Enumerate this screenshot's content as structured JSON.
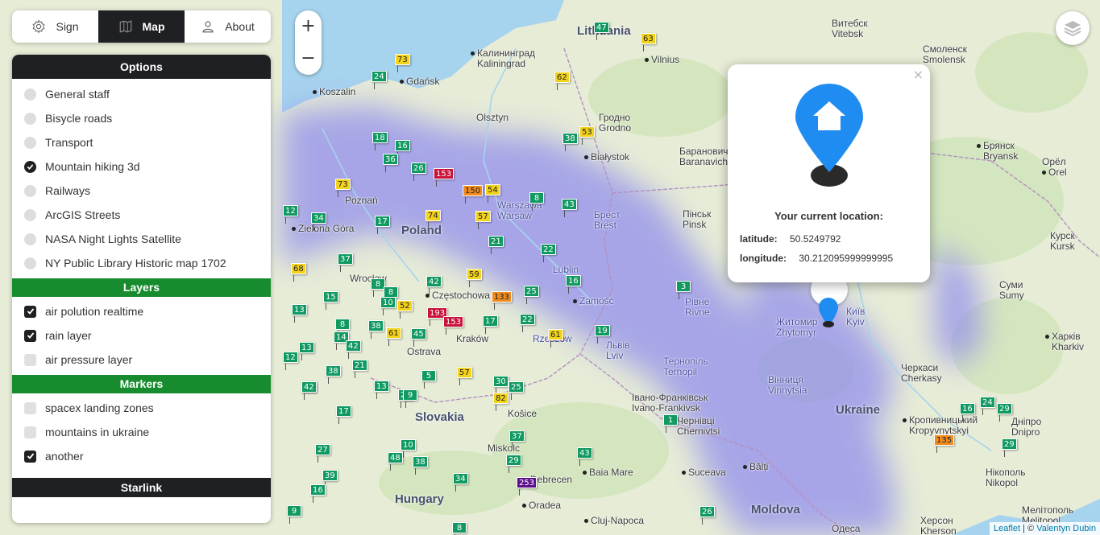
{
  "nav": {
    "tabs": [
      {
        "label": "Sign",
        "icon": "gear-icon"
      },
      {
        "label": "Map",
        "icon": "map-icon",
        "active": true
      },
      {
        "label": "About",
        "icon": "user-icon"
      }
    ]
  },
  "sidebar": {
    "options_title": "Options",
    "options": [
      {
        "label": "General staff",
        "selected": false
      },
      {
        "label": "Bisycle roads",
        "selected": false
      },
      {
        "label": "Transport",
        "selected": false
      },
      {
        "label": "Mountain hiking 3d",
        "selected": true
      },
      {
        "label": "Railways",
        "selected": false
      },
      {
        "label": "ArcGIS Streets",
        "selected": false
      },
      {
        "label": "NASA Night Lights Satellite",
        "selected": false
      },
      {
        "label": "NY Public Library Historic map 1702",
        "selected": false
      }
    ],
    "layers_title": "Layers",
    "layers": [
      {
        "label": "air polution realtime",
        "checked": true
      },
      {
        "label": "rain layer",
        "checked": true
      },
      {
        "label": "air pressure layer",
        "checked": false
      }
    ],
    "markers_title": "Markers",
    "markers": [
      {
        "label": "spacex landing zones",
        "checked": false
      },
      {
        "label": "mountains in ukraine",
        "checked": false
      },
      {
        "label": "another",
        "checked": true
      }
    ],
    "starlink_title": "Starlink"
  },
  "map": {
    "zoom_in": "+",
    "zoom_out": "−",
    "countries": [
      "Poland",
      "Slovakia",
      "Hungary",
      "Ukraine",
      "Moldova",
      "Lithuania"
    ],
    "cities": [
      "Koszalin",
      "Gdańsk",
      "Калининград",
      "Kaliningrad",
      "Olsztyn",
      "Vilnius",
      "Гродно",
      "Grodno",
      "Białystok",
      "Poznań",
      "Zielona Góra",
      "Warszawa",
      "Warsaw",
      "Брест",
      "Brest",
      "Lublin",
      "Zamość",
      "Częstochowa",
      "Kraków",
      "Rzeszów",
      "Wrocław",
      "Ostrava",
      "Košice",
      "Miskolc",
      "Debrecen",
      "Oradea",
      "Львів",
      "Lviv",
      "Тернопіль",
      "Ternopil",
      "Івано-Франківськ",
      "Ivano-Frankivsk",
      "Чернівці",
      "Chernivtsi",
      "Suceava",
      "Bălți",
      "Baia Mare",
      "Cluj-Napoca",
      "Пінськ",
      "Pinsk",
      "Рівне",
      "Rivne",
      "Житомир",
      "Zhytomyr",
      "Київ",
      "Kyiv",
      "Вінниця",
      "Vinnytsia",
      "Черкаси",
      "Cherkasy",
      "Кропивницький",
      "Kropyvnytskyi",
      "Дніпро",
      "Dnipro",
      "Нікополь",
      "Nikopol",
      "Мелітополь",
      "Melitopol",
      "Херсон",
      "Kherson",
      "Одеса",
      "Барановичи",
      "Baranavichy",
      "Витебск",
      "Vitebsk",
      "Смоленск",
      "Smolensk",
      "Брянск",
      "Bryansk",
      "Орёл",
      "Orel",
      "Курск",
      "Kursk",
      "Суми",
      "Sumy",
      "Харків",
      "Kharkiv"
    ],
    "aqi_markers": [
      {
        "v": "47",
        "c": "g"
      },
      {
        "v": "63",
        "c": "y"
      },
      {
        "v": "73",
        "c": "y"
      },
      {
        "v": "24",
        "c": "g"
      },
      {
        "v": "62",
        "c": "y"
      },
      {
        "v": "53",
        "c": "y"
      },
      {
        "v": "38",
        "c": "g"
      },
      {
        "v": "18",
        "c": "g"
      },
      {
        "v": "16",
        "c": "g"
      },
      {
        "v": "36",
        "c": "g"
      },
      {
        "v": "26",
        "c": "g"
      },
      {
        "v": "153",
        "c": "r"
      },
      {
        "v": "150",
        "c": "o"
      },
      {
        "v": "54",
        "c": "y"
      },
      {
        "v": "73",
        "c": "y"
      },
      {
        "v": "8",
        "c": "g"
      },
      {
        "v": "43",
        "c": "g"
      },
      {
        "v": "74",
        "c": "y"
      },
      {
        "v": "57",
        "c": "y"
      },
      {
        "v": "12",
        "c": "g"
      },
      {
        "v": "34",
        "c": "g"
      },
      {
        "v": "17",
        "c": "g"
      },
      {
        "v": "21",
        "c": "g"
      },
      {
        "v": "22",
        "c": "g"
      },
      {
        "v": "37",
        "c": "g"
      },
      {
        "v": "68",
        "c": "y"
      },
      {
        "v": "59",
        "c": "y"
      },
      {
        "v": "42",
        "c": "g"
      },
      {
        "v": "16",
        "c": "g"
      },
      {
        "v": "8",
        "c": "g"
      },
      {
        "v": "8",
        "c": "g"
      },
      {
        "v": "25",
        "c": "g"
      },
      {
        "v": "3",
        "c": "g"
      },
      {
        "v": "13",
        "c": "g"
      },
      {
        "v": "15",
        "c": "g"
      },
      {
        "v": "10",
        "c": "g"
      },
      {
        "v": "52",
        "c": "y"
      },
      {
        "v": "133",
        "c": "o"
      },
      {
        "v": "193",
        "c": "r"
      },
      {
        "v": "153",
        "c": "r"
      },
      {
        "v": "8",
        "c": "g"
      },
      {
        "v": "38",
        "c": "g"
      },
      {
        "v": "61",
        "c": "y"
      },
      {
        "v": "45",
        "c": "g"
      },
      {
        "v": "17",
        "c": "g"
      },
      {
        "v": "22",
        "c": "g"
      },
      {
        "v": "61",
        "c": "y"
      },
      {
        "v": "19",
        "c": "g"
      },
      {
        "v": "14",
        "c": "g"
      },
      {
        "v": "42",
        "c": "g"
      },
      {
        "v": "13",
        "c": "g"
      },
      {
        "v": "21",
        "c": "g"
      },
      {
        "v": "12",
        "c": "g"
      },
      {
        "v": "38",
        "c": "g"
      },
      {
        "v": "57",
        "c": "y"
      },
      {
        "v": "5",
        "c": "g"
      },
      {
        "v": "9",
        "c": "g"
      },
      {
        "v": "42",
        "c": "g"
      },
      {
        "v": "13",
        "c": "g"
      },
      {
        "v": "25",
        "c": "g"
      },
      {
        "v": "30",
        "c": "g"
      },
      {
        "v": "82",
        "c": "y"
      },
      {
        "v": "25",
        "c": "g"
      },
      {
        "v": "9",
        "c": "g"
      },
      {
        "v": "17",
        "c": "g"
      },
      {
        "v": "27",
        "c": "g"
      },
      {
        "v": "37",
        "c": "g"
      },
      {
        "v": "10",
        "c": "g"
      },
      {
        "v": "48",
        "c": "g"
      },
      {
        "v": "38",
        "c": "g"
      },
      {
        "v": "29",
        "c": "g"
      },
      {
        "v": "34",
        "c": "g"
      },
      {
        "v": "253",
        "c": "p"
      },
      {
        "v": "43",
        "c": "g"
      },
      {
        "v": "39",
        "c": "g"
      },
      {
        "v": "16",
        "c": "g"
      },
      {
        "v": "9",
        "c": "g"
      },
      {
        "v": "1",
        "c": "g"
      },
      {
        "v": "26",
        "c": "g"
      },
      {
        "v": "8",
        "c": "g"
      },
      {
        "v": "135",
        "c": "o"
      },
      {
        "v": "24",
        "c": "g"
      },
      {
        "v": "16",
        "c": "g"
      },
      {
        "v": "29",
        "c": "g"
      },
      {
        "v": "29",
        "c": "g"
      }
    ],
    "popup": {
      "title": "Your current location:",
      "latitude_label": "latitude:",
      "latitude_value": "50.5249792",
      "longitude_label": "longitude:",
      "longitude_value": "30.212095999999995",
      "close": "×"
    },
    "attribution": {
      "leaflet": "Leaflet",
      "sep": " | © ",
      "author": "Valentyn Dubin"
    }
  },
  "colors": {
    "dark": "#1f2024",
    "green": "#178c2e",
    "aqi_good": "#109a62",
    "aqi_moderate": "#f3d21a",
    "aqi_sensitive": "#f28b1f",
    "aqi_unhealthy": "#c9123a",
    "aqi_very_unhealthy": "#5d0f8c",
    "location_pin": "#1e8cf0"
  }
}
